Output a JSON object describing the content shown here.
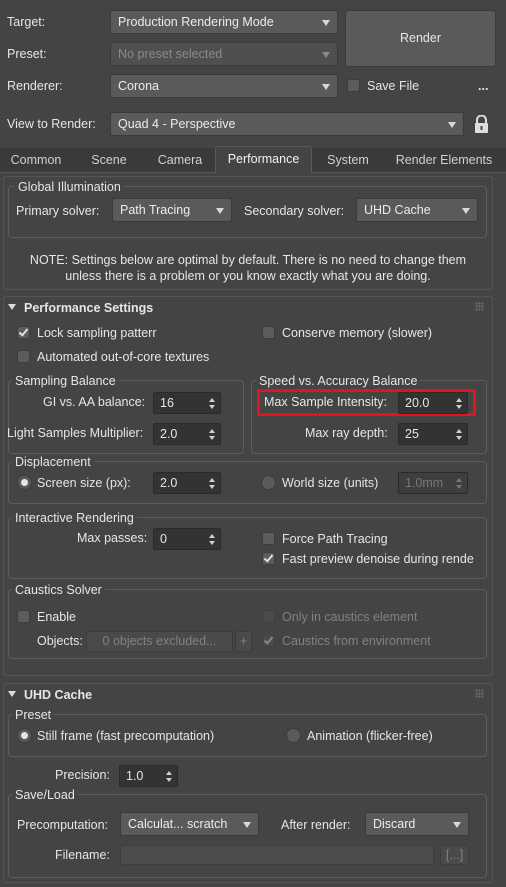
{
  "header": {
    "target_label": "Target:",
    "target_value": "Production Rendering Mode",
    "preset_label": "Preset:",
    "preset_value": "No preset selected",
    "renderer_label": "Renderer:",
    "renderer_value": "Corona",
    "save_file_label": "Save File",
    "save_file_checked": false,
    "more_label": "...",
    "view_label": "View to Render:",
    "view_value": "Quad 4 - Perspective",
    "render_button": "Render"
  },
  "tabs": [
    {
      "label": "Common",
      "active": false
    },
    {
      "label": "Scene",
      "active": false
    },
    {
      "label": "Camera",
      "active": false
    },
    {
      "label": "Performance",
      "active": true
    },
    {
      "label": "System",
      "active": false
    },
    {
      "label": "Render Elements",
      "active": false
    }
  ],
  "gi": {
    "title": "Global Illumination",
    "primary_label": "Primary solver:",
    "primary_value": "Path Tracing",
    "secondary_label": "Secondary solver:",
    "secondary_value": "UHD Cache"
  },
  "note": {
    "line1": "NOTE: Settings below are optimal by default. There is no need to change them",
    "line2": "unless there is a problem or you know exactly what you are doing."
  },
  "performance": {
    "title": "Performance Settings",
    "lock_sampling": "Lock sampling patterr",
    "lock_sampling_checked": true,
    "conserve_memory": "Conserve memory (slower)",
    "conserve_memory_checked": false,
    "out_of_core": "Automated out-of-core textures",
    "out_of_core_checked": false,
    "sampling_title": "Sampling Balance",
    "gi_aa_label": "GI vs. AA balance:",
    "gi_aa_value": "16",
    "light_mult_label": "Light Samples Multiplier:",
    "light_mult_value": "2.0",
    "speed_title": "Speed vs. Accuracy Balance",
    "max_intensity_label": "Max Sample Intensity:",
    "max_intensity_value": "20.0",
    "max_ray_label": "Max ray depth:",
    "max_ray_value": "25",
    "highlight_color": "#e0141e",
    "displacement_title": "Displacement",
    "screen_size_label": "Screen size (px):",
    "screen_size_value": "2.0",
    "world_size_label": "World size (units)",
    "world_size_value": "1.0mm",
    "interactive_title": "Interactive Rendering",
    "max_passes_label": "Max passes:",
    "max_passes_value": "0",
    "force_pt_label": "Force Path Tracing",
    "force_pt_checked": false,
    "fast_denoise_label": "Fast preview denoise during rende",
    "fast_denoise_checked": true,
    "caustics_title": "Caustics Solver",
    "enable_label": "Enable",
    "enable_checked": false,
    "only_caustics_label": "Only in caustics element",
    "objects_label": "Objects:",
    "objects_value": "0 objects excluded...",
    "add_label": "+",
    "caustics_env_label": "Caustics from environment",
    "caustics_env_checked": true
  },
  "uhd": {
    "title": "UHD Cache",
    "preset_title": "Preset",
    "still_frame": "Still frame (fast precomputation)",
    "animation": "Animation (flicker-free)",
    "precision_label": "Precision:",
    "precision_value": "1.0",
    "saveload_title": "Save/Load",
    "precomp_label": "Precomputation:",
    "precomp_value": "Calculat... scratch",
    "after_label": "After render:",
    "after_value": "Discard",
    "filename_label": "Filename:",
    "filename_value": "",
    "browse_label": "[...]"
  }
}
